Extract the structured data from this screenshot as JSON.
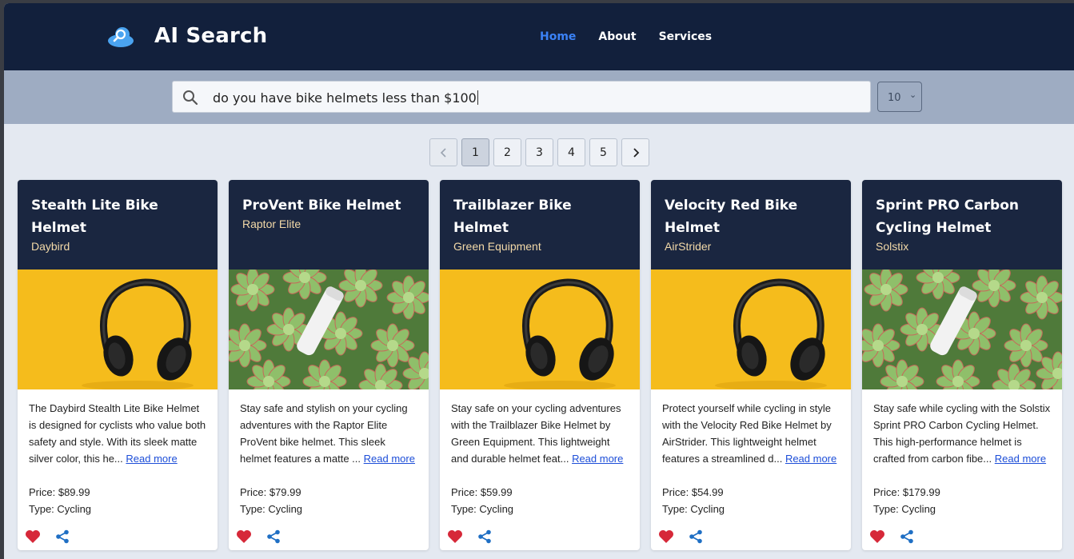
{
  "app": {
    "brand": "AI Search",
    "nav": [
      {
        "label": "Home",
        "active": true
      },
      {
        "label": "About",
        "active": false
      },
      {
        "label": "Services",
        "active": false
      }
    ],
    "colors": {
      "header_bg": "#12203c",
      "nav_active": "#3b82f6",
      "card_head_bg": "#1a2640",
      "brand_text": "#f3d9a8"
    }
  },
  "search": {
    "value": "do you have bike helmets less than $100",
    "icon": "search-icon",
    "results_per_page": "10"
  },
  "pagination": {
    "prev_icon": "chevron-left-icon",
    "next_icon": "chevron-right-icon",
    "pages": [
      "1",
      "2",
      "3",
      "4",
      "5"
    ],
    "current": "1"
  },
  "products": [
    {
      "title": "Stealth Lite Bike Helmet",
      "brand": "Daybird",
      "image": "headphones-image",
      "description": "The Daybird Stealth Lite Bike Helmet is designed for cyclists who value both safety and style. With its sleek matte silver color, this he...",
      "read_more": "Read more",
      "price": "Price: $89.99",
      "type": "Type: Cycling"
    },
    {
      "title": "ProVent Bike Helmet",
      "brand": "Raptor Elite",
      "image": "succulent-image",
      "description": "Stay safe and stylish on your cycling adventures with the Raptor Elite ProVent bike helmet. This sleek helmet features a matte ...",
      "read_more": "Read more",
      "price": "Price: $79.99",
      "type": "Type: Cycling"
    },
    {
      "title": "Trailblazer Bike Helmet",
      "brand": "Green Equipment",
      "image": "headphones-image",
      "description": "Stay safe on your cycling adventures with the Trailblazer Bike Helmet by Green Equipment. This lightweight and durable helmet feat...",
      "read_more": "Read more",
      "price": "Price: $59.99",
      "type": "Type: Cycling"
    },
    {
      "title": "Velocity Red Bike Helmet",
      "brand": "AirStrider",
      "image": "headphones-image",
      "description": "Protect yourself while cycling in style with the Velocity Red Bike Helmet by AirStrider. This lightweight helmet features a streamlined d...",
      "read_more": "Read more",
      "price": "Price: $54.99",
      "type": "Type: Cycling"
    },
    {
      "title": "Sprint PRO Carbon Cycling Helmet",
      "brand": "Solstix",
      "image": "succulent-image",
      "description": "Stay safe while cycling with the Solstix Sprint PRO Carbon Cycling Helmet. This high-performance helmet is crafted from carbon fibe...",
      "read_more": "Read more",
      "price": "Price: $179.99",
      "type": "Type: Cycling"
    }
  ]
}
